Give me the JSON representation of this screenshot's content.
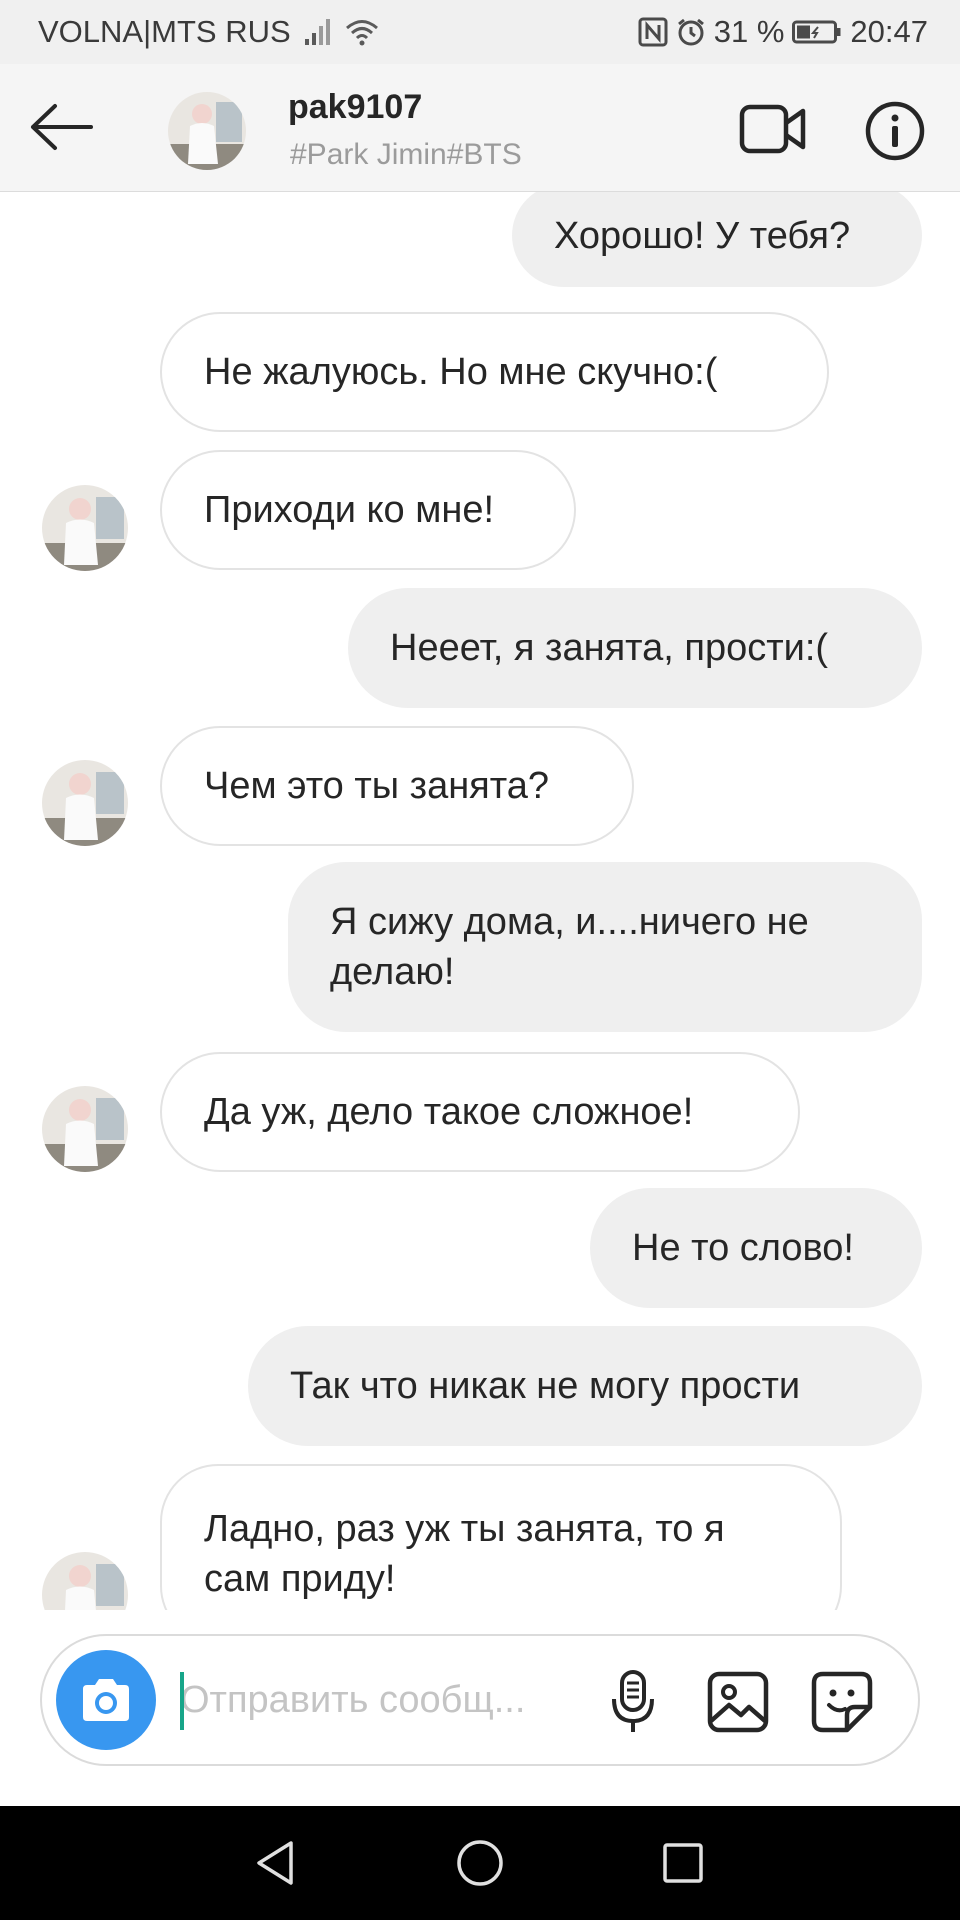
{
  "status_bar": {
    "carrier": "VOLNA|MTS RUS",
    "battery_percent": "31 %",
    "time": "20:47",
    "icons": [
      "signal-icon",
      "wifi-icon",
      "nfc-icon",
      "alarm-icon",
      "battery-icon"
    ]
  },
  "header": {
    "username": "pak9107",
    "subtitle": "#Park Jimin#BTS",
    "icons": [
      "back-arrow-icon",
      "video-camera-icon",
      "info-icon"
    ]
  },
  "messages": [
    {
      "side": "out",
      "text": "Хорошо! У тебя?"
    },
    {
      "side": "in",
      "text": "Не жалуюсь. Но мне скучно:("
    },
    {
      "side": "in",
      "text": "Приходи ко мне!"
    },
    {
      "side": "out",
      "text": "Нееет, я занята, прости:("
    },
    {
      "side": "in",
      "text": "Чем это ты занята?"
    },
    {
      "side": "out",
      "text": "Я сижу дома, и....ничего не делаю!"
    },
    {
      "side": "in",
      "text": "Да уж, дело такое сложное!"
    },
    {
      "side": "out",
      "text": "Не то слово!"
    },
    {
      "side": "out",
      "text": "Так что никак не могу прости"
    },
    {
      "side": "in",
      "text": "Ладно, раз уж ты занята, то я сам приду!"
    }
  ],
  "composer": {
    "placeholder": "Отправить сообщ...",
    "value": "",
    "accent_color": "#3897f0",
    "icons": [
      "camera-icon",
      "microphone-icon",
      "gallery-icon",
      "sticker-icon"
    ]
  },
  "nav_bar": {
    "icons": [
      "nav-back-icon",
      "nav-home-icon",
      "nav-recents-icon"
    ]
  }
}
